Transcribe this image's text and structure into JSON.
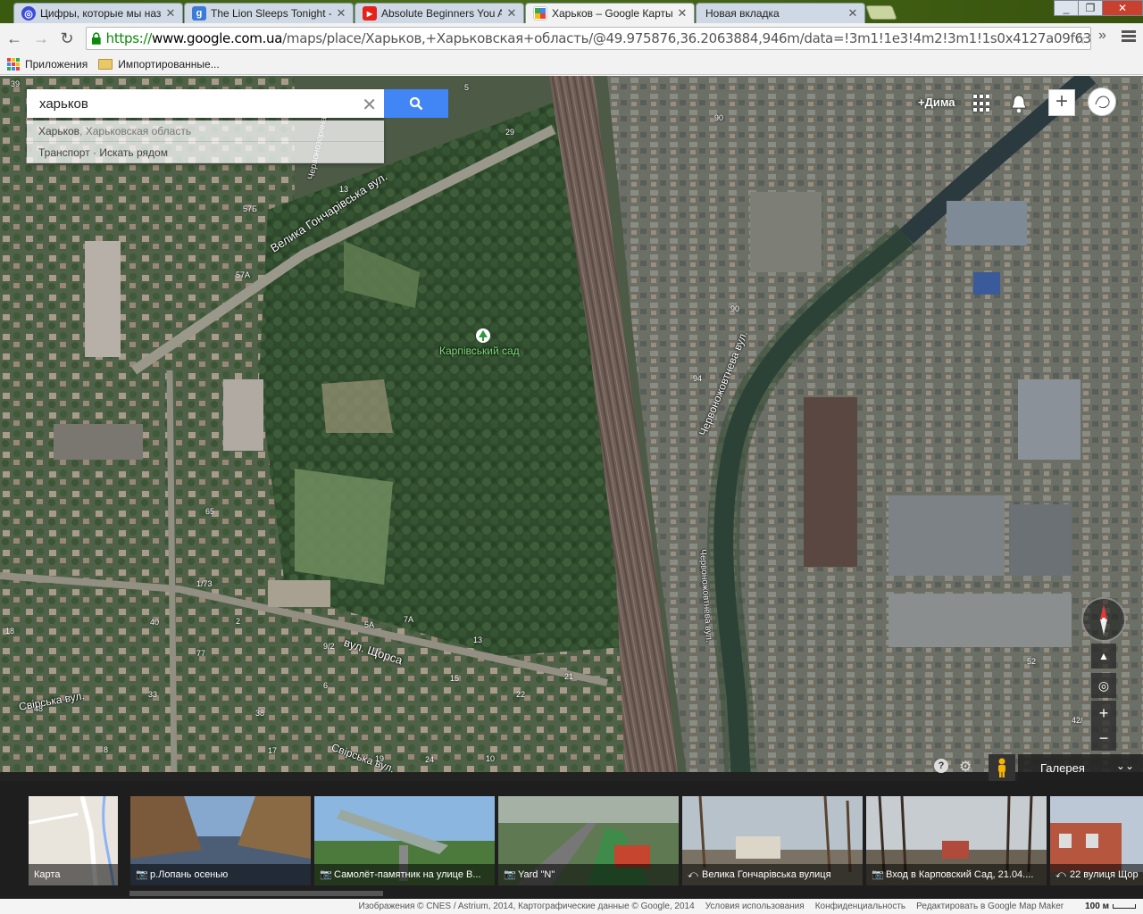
{
  "browser": {
    "tabs": [
      {
        "title": "Цифры, которые мы наз",
        "color": "#3b4bd8",
        "glyph": "◎"
      },
      {
        "title": "The Lion Sleeps Tonight -",
        "color": "#3d7bd9",
        "glyph": "g"
      },
      {
        "title": "Absolute Beginners You A",
        "color": "#e62117",
        "glyph": "▶"
      },
      {
        "title": "Харьков – Google Карты",
        "color": "#34a853",
        "glyph": "📍"
      },
      {
        "title": "Новая вкладка",
        "color": "",
        "glyph": ""
      }
    ],
    "window_buttons": {
      "minimize": "_",
      "maximize": "❐",
      "close": "✕"
    },
    "url": {
      "scheme": "https://",
      "host": "www.google.com.ua",
      "path": "/maps/place/Харьков,+Харьковская+область/@49.975876,36.2063884,946m/data=!3m1!1e3!4m2!3m1!1s0x4127a09f63ab0"
    },
    "bookmarks": [
      {
        "label": "Приложения"
      },
      {
        "label": "Импортированные..."
      }
    ]
  },
  "maps": {
    "search": {
      "value": "харьков",
      "suggestions": [
        {
          "main": "Харьков",
          "secondary": ", Харьковская область"
        },
        {
          "main": "Транспорт · Искать рядом",
          "secondary": ""
        }
      ]
    },
    "user": {
      "plus_name": "+Дима"
    },
    "place": {
      "name": "Карпівський сад"
    },
    "street_labels": [
      {
        "text": "Велика Гончарівська вул."
      },
      {
        "text": "Червонозоряна вул."
      },
      {
        "text": "Червоножовтнева вул."
      },
      {
        "text": "вул. Щорса"
      },
      {
        "text": "Свірська вул."
      },
      {
        "text": "Свірська вул."
      },
      {
        "text": "Червоножовтнева вул."
      }
    ],
    "house_numbers": [
      "39",
      "5",
      "29",
      "13",
      "57Б",
      "57А",
      "90",
      "90",
      "94",
      "65",
      "1/73",
      "40",
      "5А",
      "7А",
      "9/2",
      "13",
      "15",
      "21",
      "22",
      "33",
      "38",
      "24",
      "2",
      "8",
      "77",
      "18",
      "6",
      "17",
      "10",
      "52",
      "42/",
      "48",
      "19"
    ],
    "gallery_label": "Галерея",
    "controls": {
      "zoom_in": "+",
      "zoom_out": "−",
      "help": "?"
    }
  },
  "photostrip": {
    "items": [
      {
        "caption": "Карта",
        "type": "map"
      },
      {
        "caption": "р.Лопань осенью",
        "type": "camera"
      },
      {
        "caption": "Самолёт-памятник на улице В...",
        "type": "camera"
      },
      {
        "caption": "Yard \"N\"",
        "type": "camera"
      },
      {
        "caption": "Велика Гончарівська вулиця",
        "type": "streetview"
      },
      {
        "caption": "Вход в Карповский Сад, 21.04....",
        "type": "camera"
      },
      {
        "caption": "22 вулиця Щор",
        "type": "streetview"
      }
    ]
  },
  "footer": {
    "imagery": "Изображения © CNES / Astrium, 2014, Картографические данные © Google, 2014",
    "terms": "Условия использования",
    "privacy": "Конфиденциальность",
    "report": "Редактировать в Google Map Maker",
    "scale": "100 м"
  }
}
